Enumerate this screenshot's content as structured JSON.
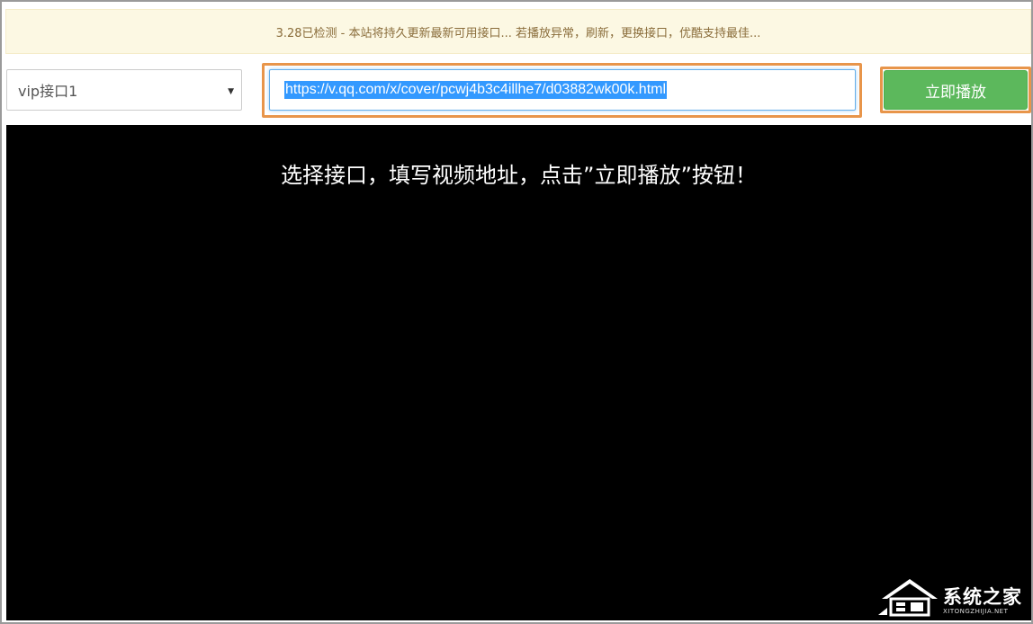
{
  "notice": {
    "text": "3.28已检测 - 本站将持久更新最新可用接口... 若播放异常，刷新，更换接口，优酷支持最佳..."
  },
  "controls": {
    "interface_select": {
      "selected": "vip接口1"
    },
    "url_input": {
      "value": "https://v.qq.com/x/cover/pcwj4b3c4illhe7/d03882wk00k.html"
    },
    "play_button": {
      "label": "立即播放"
    }
  },
  "player": {
    "message": "选择接口，填写视频地址，点击”立即播放”按钮！"
  },
  "watermark": {
    "text": "系统之家",
    "subtext": "XITONGZHIJIA.NET"
  },
  "colors": {
    "notice_bg": "#fcf8e3",
    "notice_text": "#8a6d3b",
    "highlight": "#e8954a",
    "play_button": "#5cb85c",
    "player_bg": "#000000",
    "selection": "#3399ff"
  }
}
